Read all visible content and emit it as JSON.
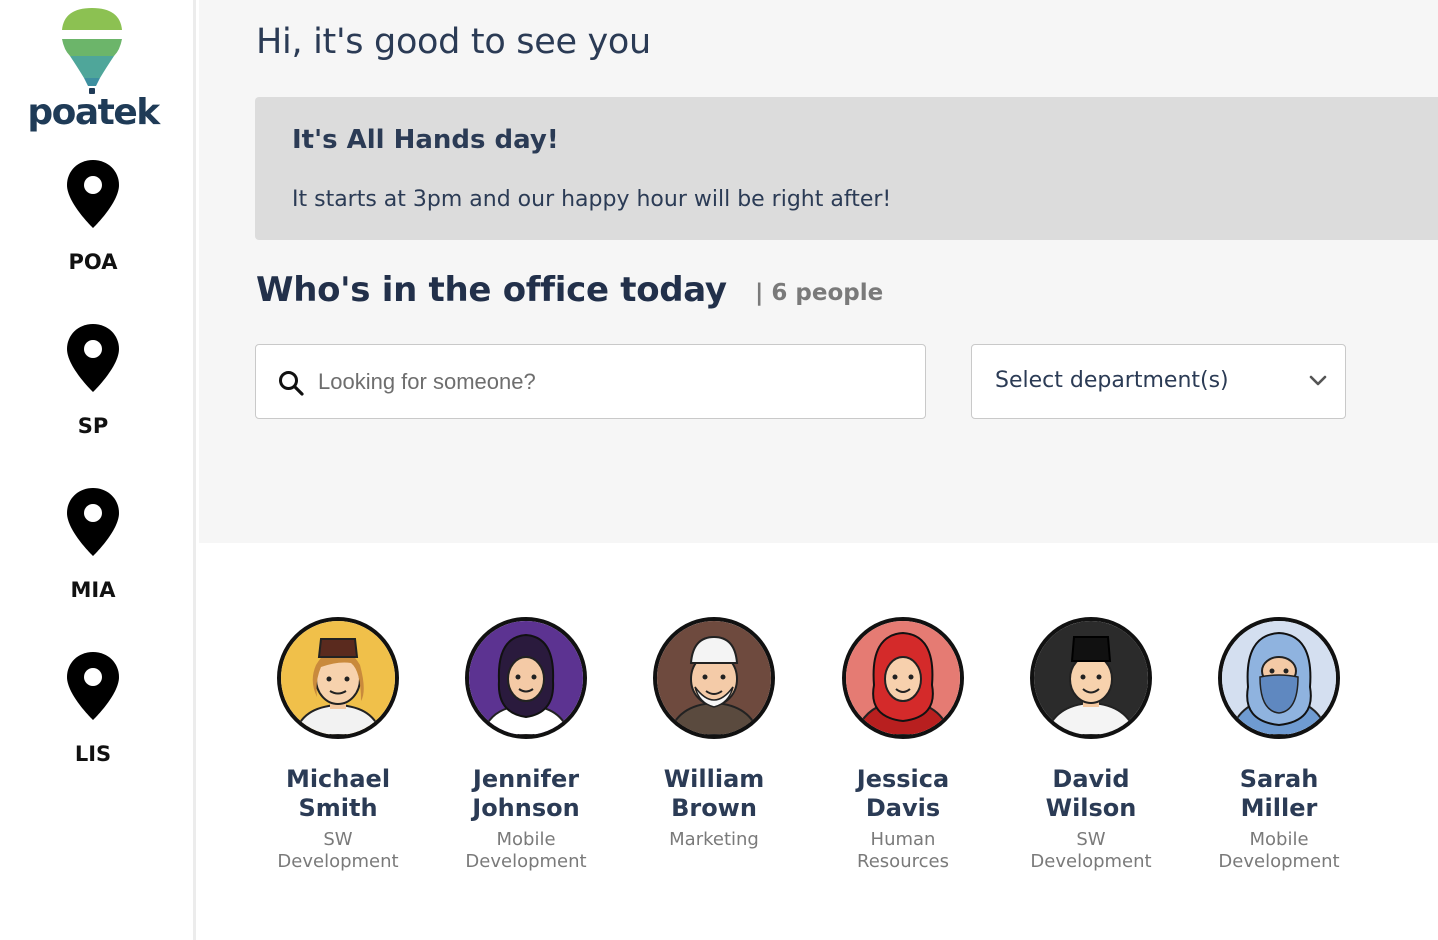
{
  "brand": {
    "name": "poatek"
  },
  "locations": [
    {
      "label": "POA"
    },
    {
      "label": "SP"
    },
    {
      "label": "MIA"
    },
    {
      "label": "LIS"
    }
  ],
  "greeting": "Hi, it's good to see you",
  "announcement": {
    "title": "It's All Hands day!",
    "text": "It starts at 3pm and our happy hour will be right after!"
  },
  "office": {
    "title": "Who's in the office today",
    "count_label": "| 6 people"
  },
  "search": {
    "placeholder": "Looking for someone?",
    "value": ""
  },
  "department_select": {
    "value": "Select department(s)"
  },
  "people": [
    {
      "first": "Michael",
      "last": "Smith",
      "dept1": "SW",
      "dept2": "Development",
      "bg": "#f0c04a"
    },
    {
      "first": "Jennifer",
      "last": "Johnson",
      "dept1": "Mobile",
      "dept2": "Development",
      "bg": "#5c3391"
    },
    {
      "first": "William",
      "last": "Brown",
      "dept1": "Marketing",
      "dept2": "",
      "bg": "#6e4a3e"
    },
    {
      "first": "Jessica",
      "last": "Davis",
      "dept1": "Human",
      "dept2": "Resources",
      "bg": "#e57b73"
    },
    {
      "first": "David",
      "last": "Wilson",
      "dept1": "SW",
      "dept2": "Development",
      "bg": "#2b2b2b"
    },
    {
      "first": "Sarah",
      "last": "Miller",
      "dept1": "Mobile",
      "dept2": "Development",
      "bg": "#d4dff0"
    }
  ]
}
